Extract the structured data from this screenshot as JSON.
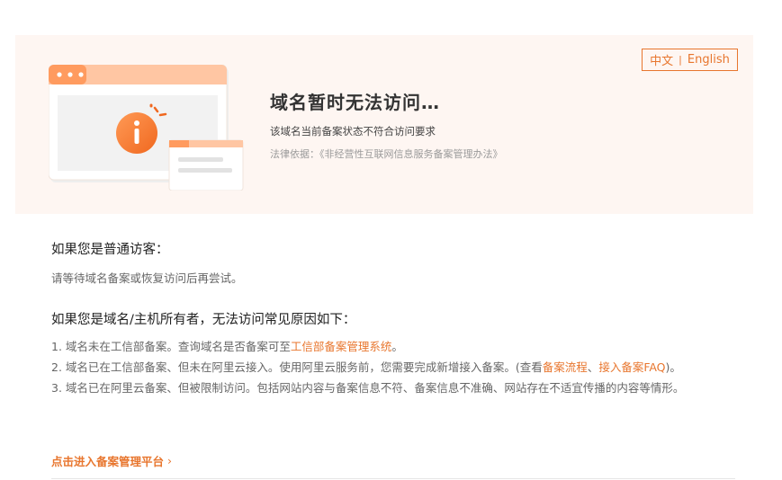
{
  "lang": {
    "zh": "中文",
    "separator": "|",
    "en": "English"
  },
  "header": {
    "title": "域名暂时无法访问…",
    "subtitle": "该域名当前备案状态不符合访问要求",
    "law": "法律依据：《非经营性互联网信息服务备案管理办法》"
  },
  "visitor": {
    "title": "如果您是普通访客：",
    "text": "请等待域名备案或恢复访问后再尝试。"
  },
  "owner": {
    "title": "如果您是域名/主机所有者，无法访问常见原因如下：",
    "reason1": {
      "text": "1. 域名未在工信部备案。查询域名是否备案可至",
      "link": "工信部备案管理系统",
      "end": "。"
    },
    "reason2": {
      "text": "2. 域名已在工信部备案、但未在阿里云接入。使用阿里云服务前，您需要完成新增接入备案。(查看",
      "link1": "备案流程",
      "sep": "、",
      "link2": "接入备案FAQ",
      "end": ")。"
    },
    "reason3": {
      "text": "3. 域名已在阿里云备案、但被限制访问。包括网站内容与备案信息不符、备案信息不准确、网站存在不适宜传播的内容等情形。"
    }
  },
  "cta": {
    "label": "点击进入备案管理平台",
    "chevron": "›"
  },
  "colors": {
    "accent": "#e8762e",
    "banner_bg": "#fef6f2"
  }
}
